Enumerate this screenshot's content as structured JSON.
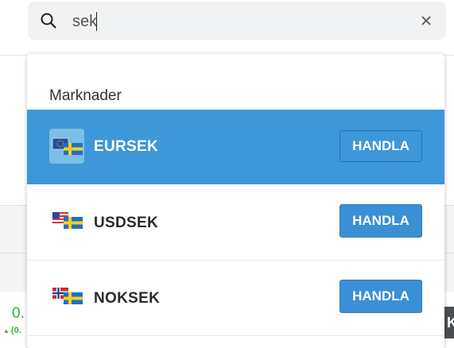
{
  "search": {
    "value": "sek",
    "placeholder": ""
  },
  "dropdown": {
    "section_title": "Marknader",
    "items": [
      {
        "symbol": "EURSEK",
        "button": "HANDLA",
        "selected": true,
        "flag_icon": "eur-sek-flag-icon"
      },
      {
        "symbol": "USDSEK",
        "button": "HANDLA",
        "selected": false,
        "flag_icon": "usd-sek-flag-icon"
      },
      {
        "symbol": "NOKSEK",
        "button": "HANDLA",
        "selected": false,
        "flag_icon": "nok-sek-flag-icon"
      }
    ]
  },
  "background": {
    "price_partial": "0.",
    "change_partial": "(0.",
    "right_button_partial": "K"
  },
  "colors": {
    "selected_row": "#3e97d8",
    "button": "#3b8fd4",
    "positive": "#3cae3c"
  }
}
